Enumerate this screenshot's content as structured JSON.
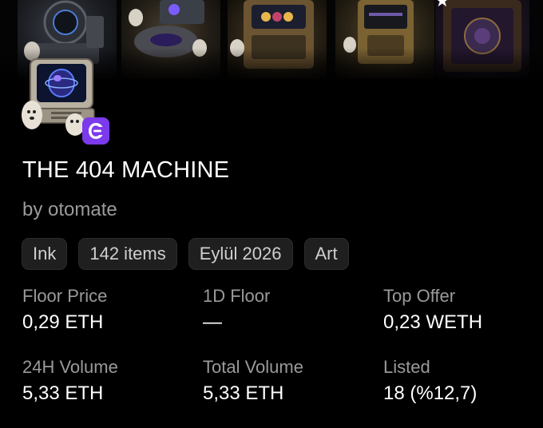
{
  "banner": {
    "tiles": [
      "tile-1",
      "tile-2",
      "tile-3",
      "tile-4",
      "tile-5"
    ],
    "star_icon": "star-icon"
  },
  "avatar": {
    "icon": "retro-computer-ghost-avatar",
    "chain_badge_icon": "ink-chain-logo-icon",
    "chain_badge_color": "#7c3aed"
  },
  "collection": {
    "title": "THE 404 MACHINE",
    "creator": "by otomate"
  },
  "tags": [
    {
      "label": "Ink"
    },
    {
      "label": "142 items"
    },
    {
      "label": "Eylül 2026"
    },
    {
      "label": "Art"
    }
  ],
  "stats": {
    "floor_price": {
      "label": "Floor Price",
      "value": "0,29 ETH"
    },
    "one_day_floor": {
      "label": "1D Floor",
      "value": "—"
    },
    "top_offer": {
      "label": "Top Offer",
      "value": "0,23 WETH"
    },
    "volume_24h": {
      "label": "24H Volume",
      "value": "5,33 ETH"
    },
    "total_volume": {
      "label": "Total Volume",
      "value": "5,33 ETH"
    },
    "listed": {
      "label": "Listed",
      "value": "18 (%12,7)"
    }
  }
}
